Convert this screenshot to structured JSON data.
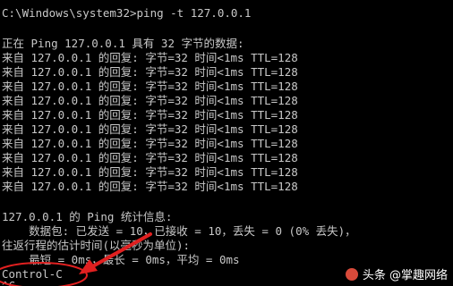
{
  "console": {
    "prompt_command": "C:\\Windows\\system32>ping -t 127.0.0.1",
    "header": "正在 Ping 127.0.0.1 具有 32 字节的数据:",
    "replies": [
      "来自 127.0.0.1 的回复: 字节=32 时间<1ms TTL=128",
      "来自 127.0.0.1 的回复: 字节=32 时间<1ms TTL=128",
      "来自 127.0.0.1 的回复: 字节=32 时间<1ms TTL=128",
      "来自 127.0.0.1 的回复: 字节=32 时间<1ms TTL=128",
      "来自 127.0.0.1 的回复: 字节=32 时间<1ms TTL=128",
      "来自 127.0.0.1 的回复: 字节=32 时间<1ms TTL=128",
      "来自 127.0.0.1 的回复: 字节=32 时间<1ms TTL=128",
      "来自 127.0.0.1 的回复: 字节=32 时间<1ms TTL=128",
      "来自 127.0.0.1 的回复: 字节=32 时间<1ms TTL=128",
      "来自 127.0.0.1 的回复: 字节=32 时间<1ms TTL=128"
    ],
    "stats_title": "127.0.0.1 的 Ping 统计信息:",
    "stats_packets": "    数据包: 已发送 = 10，已接收 = 10，丢失 = 0 (0% 丢失)，",
    "rtt_title": "往返行程的估计时间(以毫秒为单位):",
    "rtt_values": "    最短 = 0ms，最长 = 0ms，平均 = 0ms",
    "interrupt": "Control-C",
    "caret": "^C"
  },
  "colors": {
    "background": "#000000",
    "text": "#c8c8c8",
    "annotation": "#e02020"
  },
  "watermark": {
    "text": "头条 @掌趣网络"
  }
}
